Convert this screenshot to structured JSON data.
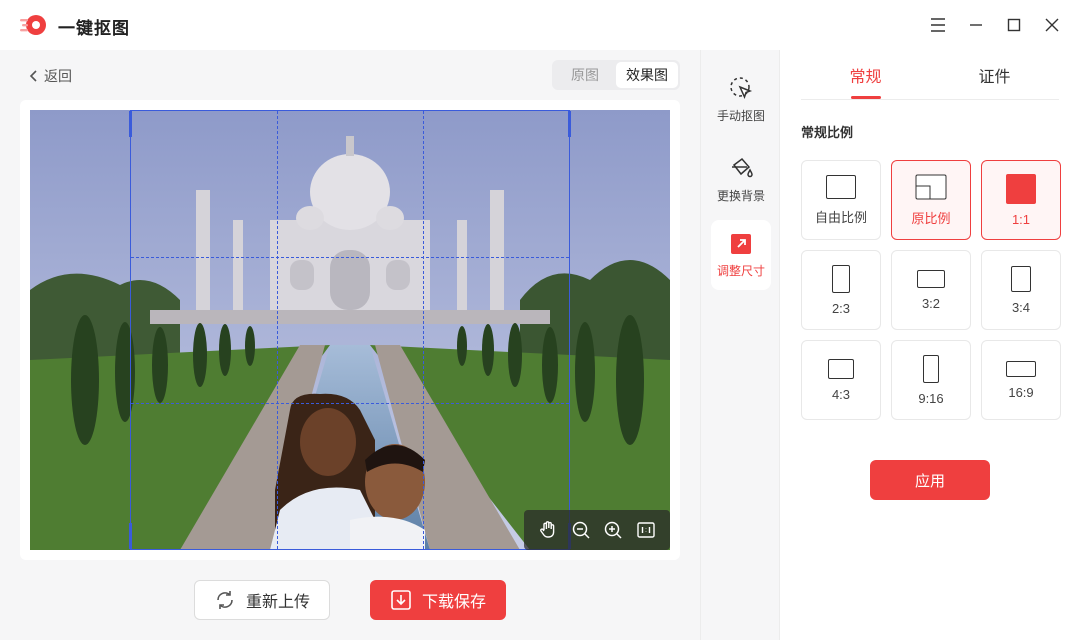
{
  "app": {
    "title": "一键抠图"
  },
  "toolbar": {
    "back_label": "返回",
    "view_options": [
      "原图",
      "效果图"
    ],
    "active_view": "效果图"
  },
  "canvas": {
    "zoom_tools": [
      "hand-tool",
      "zoom-out",
      "zoom-in",
      "actual-size"
    ]
  },
  "actions": {
    "reupload_label": "重新上传",
    "download_label": "下载保存"
  },
  "rail": {
    "items": [
      {
        "label": "手动抠图",
        "icon": "cursor-select-icon",
        "active": false
      },
      {
        "label": "更换背景",
        "icon": "paint-bucket-icon",
        "active": false
      },
      {
        "label": "调整尺寸",
        "icon": "resize-icon",
        "active": true
      }
    ]
  },
  "panel": {
    "tabs": [
      "常规",
      "证件"
    ],
    "active_tab": "常规",
    "section_title": "常规比例",
    "ratios": [
      {
        "label": "自由比例",
        "selected": false
      },
      {
        "label": "原比例",
        "selected": true
      },
      {
        "label": "1:1",
        "selected": true
      },
      {
        "label": "2:3",
        "selected": false
      },
      {
        "label": "3:2",
        "selected": false
      },
      {
        "label": "3:4",
        "selected": false
      },
      {
        "label": "4:3",
        "selected": false
      },
      {
        "label": "9:16",
        "selected": false
      },
      {
        "label": "16:9",
        "selected": false
      }
    ],
    "apply_label": "应用"
  },
  "colors": {
    "accent": "#ef3f3f",
    "crop": "#3a5bdb"
  }
}
